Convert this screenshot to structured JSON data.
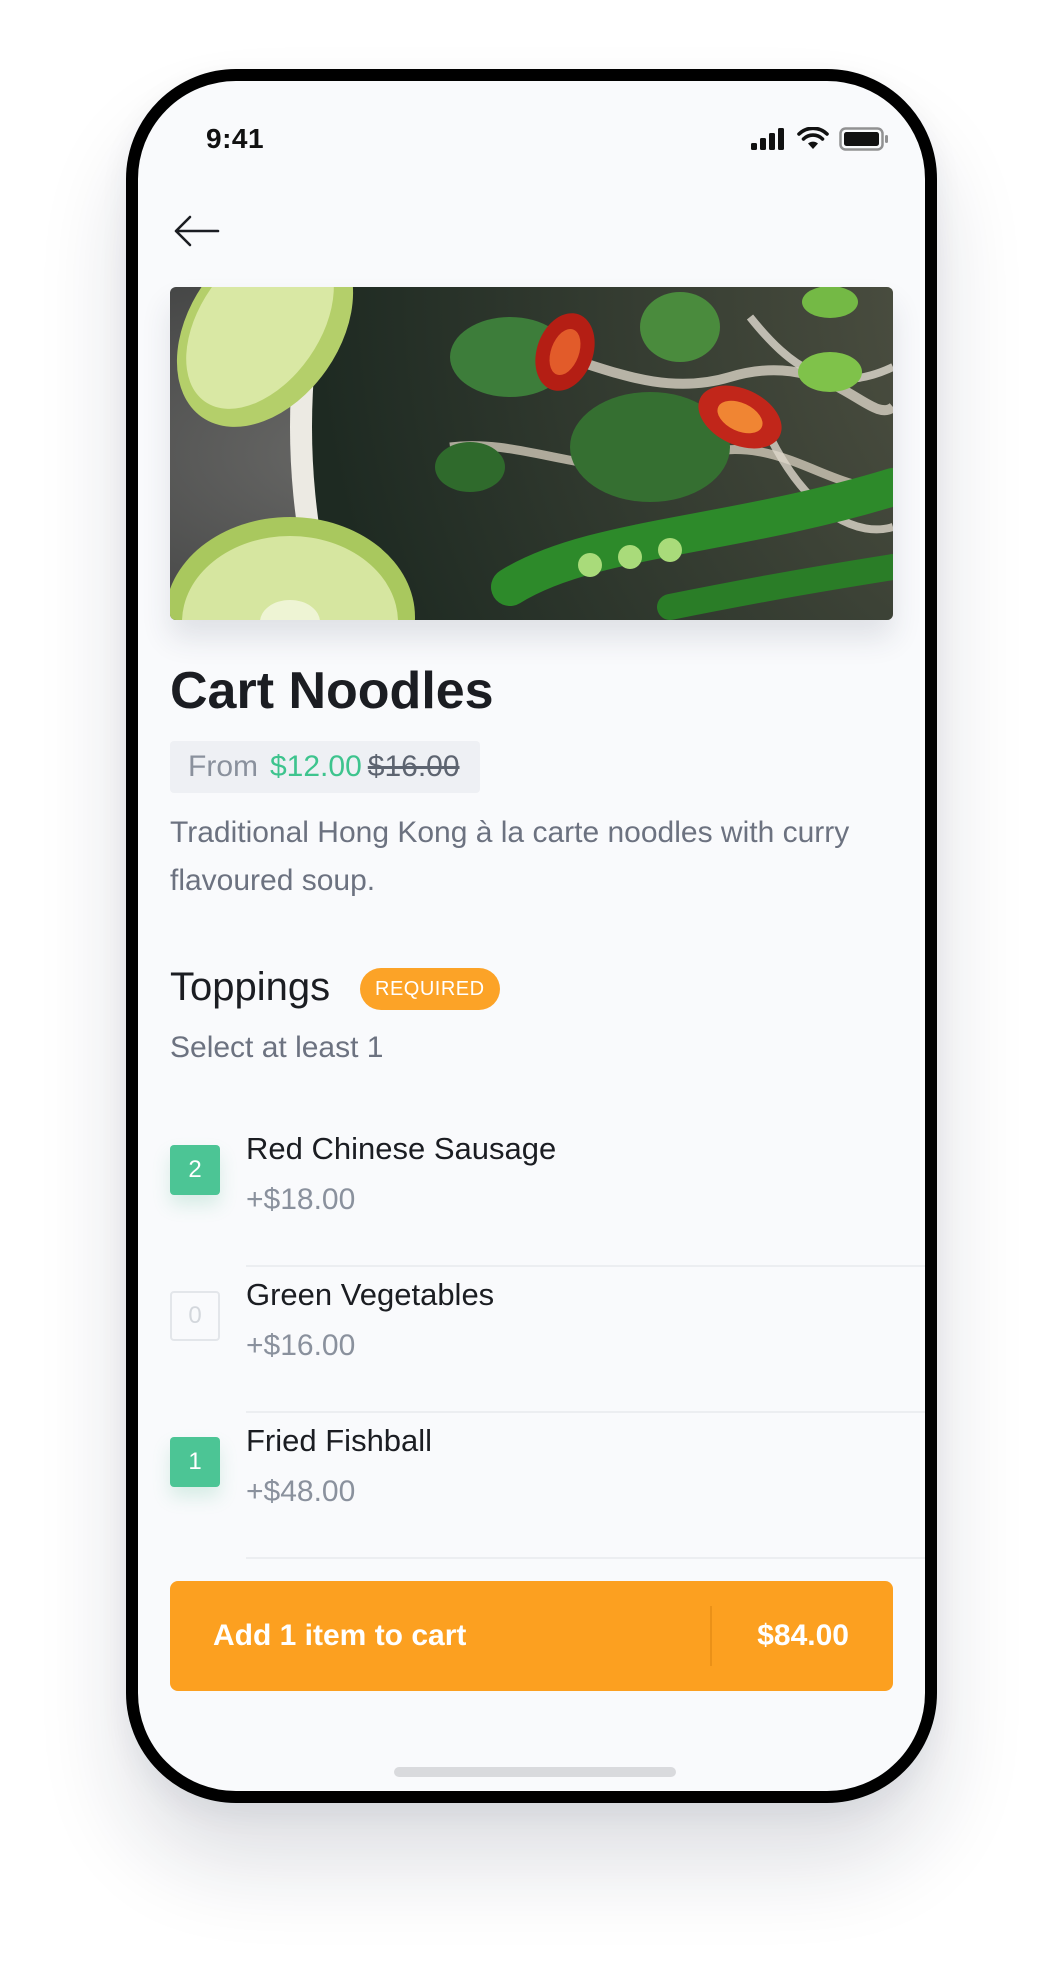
{
  "status_bar": {
    "time": "9:41"
  },
  "icons": {
    "back": "arrow-left-icon",
    "signal": "cellular-signal-icon",
    "wifi": "wifi-icon",
    "battery": "battery-icon"
  },
  "product": {
    "name": "Cart Noodles",
    "price_from_label": "From",
    "price_current": "$12.00",
    "price_original": "$16.00",
    "description": "Traditional Hong Kong à la carte noodles with curry flavoured soup."
  },
  "toppings": {
    "title": "Toppings",
    "badge": "REQUIRED",
    "subtitle": "Select at least 1",
    "items": [
      {
        "quantity": "2",
        "name": "Red Chinese Sausage",
        "price": "+$18.00"
      },
      {
        "quantity": "0",
        "name": "Green Vegetables",
        "price": "+$16.00"
      },
      {
        "quantity": "1",
        "name": "Fried Fishball",
        "price": "+$48.00"
      }
    ]
  },
  "cart_button": {
    "label": "Add 1 item to cart",
    "total": "$84.00"
  },
  "colors": {
    "accent_orange": "#fca020",
    "accent_green": "#4cc595",
    "background": "#f9fafc",
    "text_primary": "#1b1d22",
    "text_secondary": "#6c7280"
  }
}
